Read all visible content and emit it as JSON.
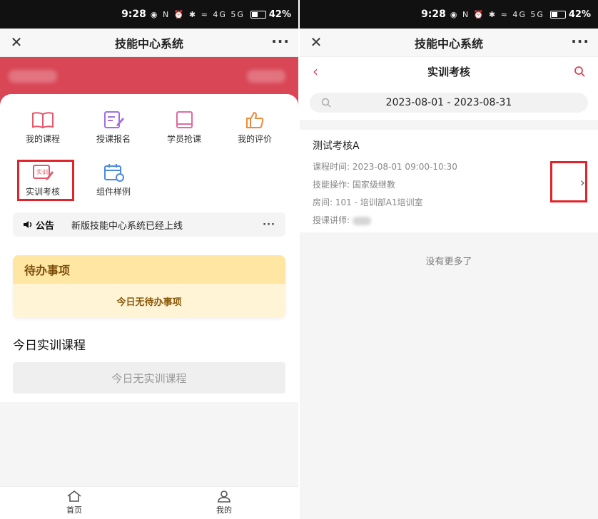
{
  "status": {
    "time": "9:28",
    "indicators": "◉ N ⏰ ✱ ≈ 4G 5G",
    "battery": "42%"
  },
  "left": {
    "appbar": {
      "title": "技能中心系统"
    },
    "grid": [
      {
        "label": "我的课程",
        "icon": "book-icon",
        "color": "#e8566a"
      },
      {
        "label": "授课报名",
        "icon": "edit-form-icon",
        "color": "#a36ee0"
      },
      {
        "label": "学员抢课",
        "icon": "notebook-icon",
        "color": "#e06aa0"
      },
      {
        "label": "我的评价",
        "icon": "thumbs-up-icon",
        "color": "#f08a3c"
      },
      {
        "label": "实训考核",
        "icon": "exam-edit-icon",
        "color": "#e8566a",
        "badge": "实训"
      },
      {
        "label": "组件样例",
        "icon": "calendar-icon",
        "color": "#4a8ae0"
      }
    ],
    "notice": {
      "title": "公告",
      "text": "新版技能中心系统已经上线",
      "more": "···"
    },
    "todo": {
      "title": "待办事项",
      "empty": "今日无待办事项"
    },
    "today": {
      "title": "今日实训课程",
      "empty": "今日无实训课程"
    },
    "tabs": [
      {
        "label": "首页",
        "icon": "home-icon"
      },
      {
        "label": "我的",
        "icon": "user-icon"
      }
    ]
  },
  "right": {
    "appbar": {
      "title": "技能中心系统"
    },
    "subbar": {
      "title": "实训考核"
    },
    "date_range": "2023-08-01 - 2023-08-31",
    "exam": {
      "title": "测试考核A",
      "rows": [
        {
          "label": "课程时间:",
          "value": "2023-08-01 09:00-10:30"
        },
        {
          "label": "技能操作:",
          "value": "国家级继教"
        },
        {
          "label": "房间:",
          "value": "101 - 培训部A1培训室"
        },
        {
          "label": "授课讲师:",
          "value": ""
        }
      ]
    },
    "no_more": "没有更多了"
  },
  "colors": {
    "accent": "#d94656",
    "highlight": "#e0242b"
  }
}
